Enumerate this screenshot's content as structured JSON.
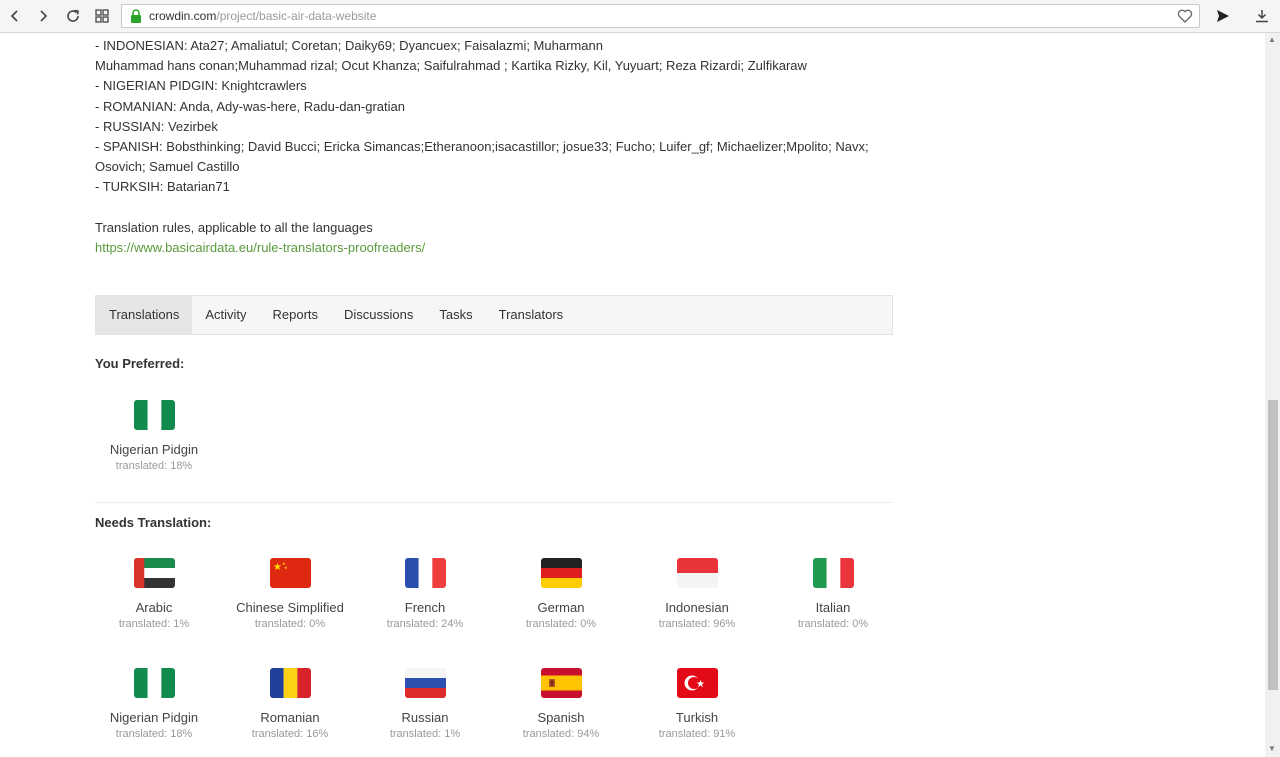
{
  "browser": {
    "url_host": "crowdin.com",
    "url_path": "/project/basic-air-data-website"
  },
  "credits": [
    "- INDONESIAN: Ata27; Amaliatul; Coretan; Daiky69; Dyancuex; Faisalazmi; Muharmann",
    "Muhammad hans conan;Muhammad rizal; Ocut Khanza; Saifulrahmad ; Kartika Rizky, Kil, Yuyuart; Reza Rizardi; Zulfikaraw",
    "- NIGERIAN PIDGIN: Knightcrawlers",
    "- ROMANIAN: Anda, Ady-was-here, Radu-dan-gratian",
    "- RUSSIAN: Vezirbek",
    "- SPANISH: Bobsthinking; David Bucci; Ericka Simancas;Etheranoon;isacastillor; josue33; Fucho; Luifer_gf; Michaelizer;Mpolito; Navx;",
    "Osovich; Samuel Castillo",
    "- TURKSIH: Batarian71"
  ],
  "rules_text": "Translation rules, applicable to all the languages",
  "rules_link": "https://www.basicairdata.eu/rule-translators-proofreaders/",
  "tabs": [
    "Translations",
    "Activity",
    "Reports",
    "Discussions",
    "Tasks",
    "Translators"
  ],
  "preferred": {
    "title": "You Preferred:",
    "languages": [
      {
        "name": "Nigerian Pidgin",
        "progress": "translated: 18%",
        "flag": "nigeria-flag"
      }
    ]
  },
  "needs": {
    "title": "Needs Translation:",
    "languages": [
      {
        "name": "Arabic",
        "progress": "translated: 1%",
        "flag": "uae-flag"
      },
      {
        "name": "Chinese Simplified",
        "progress": "translated: 0%",
        "flag": "china-flag"
      },
      {
        "name": "French",
        "progress": "translated: 24%",
        "flag": "france-flag"
      },
      {
        "name": "German",
        "progress": "translated: 0%",
        "flag": "germany-flag"
      },
      {
        "name": "Indonesian",
        "progress": "translated: 96%",
        "flag": "indonesia-flag"
      },
      {
        "name": "Italian",
        "progress": "translated: 0%",
        "flag": "italy-flag"
      },
      {
        "name": "Nigerian Pidgin",
        "progress": "translated: 18%",
        "flag": "nigeria-flag"
      },
      {
        "name": "Romanian",
        "progress": "translated: 16%",
        "flag": "romania-flag"
      },
      {
        "name": "Russian",
        "progress": "translated: 1%",
        "flag": "russia-flag"
      },
      {
        "name": "Spanish",
        "progress": "translated: 94%",
        "flag": "spain-flag"
      },
      {
        "name": "Turkish",
        "progress": "translated: 91%",
        "flag": "turkey-flag"
      }
    ]
  },
  "colors": {
    "link": "#5a9a3c",
    "tab_active_bg": "#e6e6e6",
    "tabs_bg": "#f6f6f6"
  }
}
